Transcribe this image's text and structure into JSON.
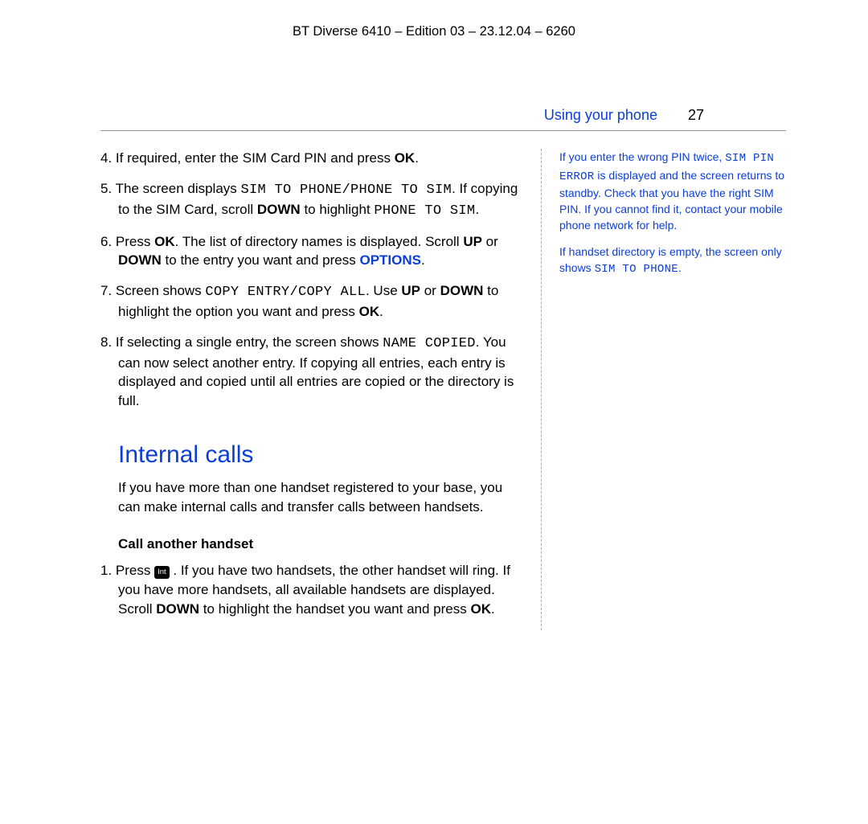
{
  "header": "BT Diverse 6410 – Edition 03 – 23.12.04 – 6260",
  "section": {
    "title": "Using your phone",
    "page": "27"
  },
  "steps_a": {
    "s4": {
      "n": "4.",
      "pre": " If required, enter the SIM Card PIN and press ",
      "ok": "OK",
      "post": "."
    },
    "s5": {
      "n": "5.",
      "pre": " The screen displays ",
      "m1": "SIM TO PHONE/PHONE TO SIM",
      "mid1": ". If copying to the SIM Card, scroll ",
      "down": "DOWN",
      "mid2": " to highlight ",
      "m2": "PHONE TO SIM",
      "post": "."
    },
    "s6": {
      "n": "6.",
      "pre": " Press ",
      "ok": "OK",
      "mid1": ". The list of directory names is displayed. Scroll ",
      "up": "UP",
      "mid2": " or ",
      "down": "DOWN",
      "mid3": " to the entry you want and press ",
      "opt": "OPTIONS",
      "post": "."
    },
    "s7": {
      "n": "7.",
      "pre": " Screen shows ",
      "m1": "COPY ENTRY/COPY ALL",
      "mid1": ". Use ",
      "up": "UP",
      "mid2": " or ",
      "down": "DOWN",
      "mid3": " to highlight the option you want and press ",
      "ok": "OK",
      "post": "."
    },
    "s8": {
      "n": "8.",
      "pre": " If selecting a single entry, the screen shows ",
      "m1": "NAME COPIED",
      "post": ". You can now select another entry. If copying all entries, each entry is displayed and copied until all entries are copied or the directory is full."
    }
  },
  "heading": "Internal calls",
  "intro": "If you have more than one handset registered to your base, you can make internal calls and transfer calls between handsets.",
  "sub_heading": "Call another handset",
  "steps_b": {
    "s1": {
      "n": "1.",
      "pre": " Press ",
      "key": "Int",
      "mid1": " . If you have two handsets, the other handset will ring. If you have more handsets, all available handsets are displayed. Scroll ",
      "down": "DOWN",
      "mid2": " to highlight the handset you want and press ",
      "ok": "OK",
      "post": "."
    }
  },
  "side": {
    "p1": {
      "a": "If you enter the wrong PIN twice, ",
      "m": "SIM PIN ERROR",
      "b": " is displayed and the screen returns to standby. Check that you have the right SIM PIN. If you cannot find it, contact your mobile phone network for help."
    },
    "p2": {
      "a": "If handset directory is empty, the screen only shows ",
      "m": "SIM TO PHONE",
      "b": "."
    }
  }
}
